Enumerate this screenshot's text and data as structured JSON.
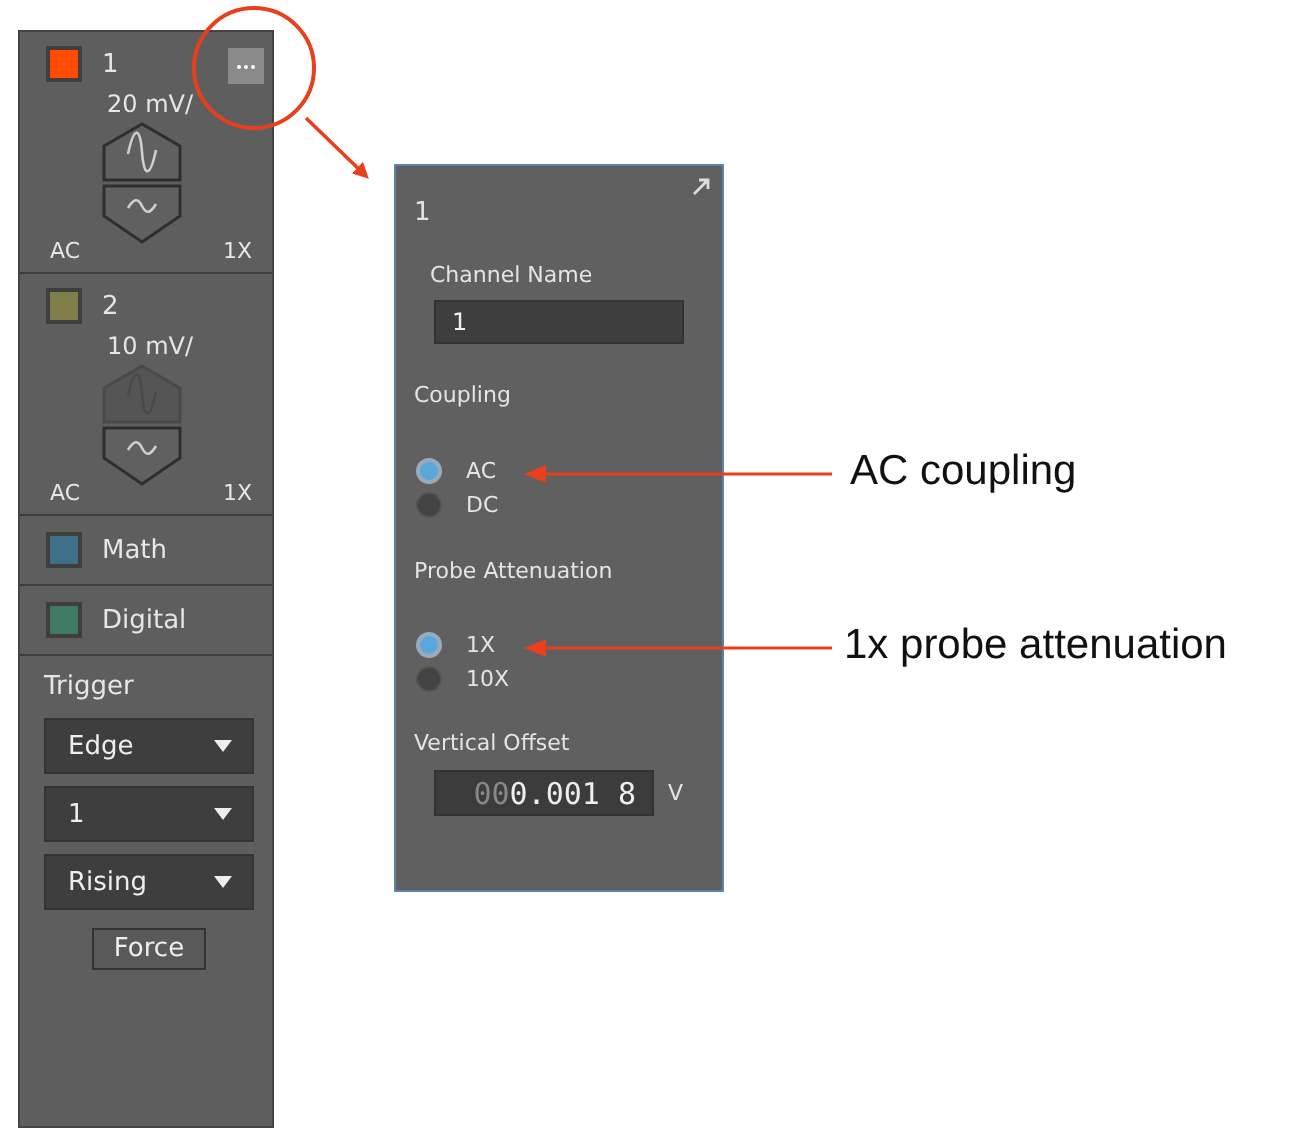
{
  "channels": [
    {
      "number": "1",
      "color": "#ff4a00",
      "menu": true,
      "scale": "20 mV/",
      "scale_up_disabled": false,
      "coupling": "AC",
      "probe": "1X"
    },
    {
      "number": "2",
      "color": "#7f7d4a",
      "menu": false,
      "scale": "10 mV/",
      "scale_up_disabled": true,
      "coupling": "AC",
      "probe": "1X"
    }
  ],
  "extra_channels": [
    {
      "label": "Math",
      "color": "#3f6f86"
    },
    {
      "label": "Digital",
      "color": "#3f7a62"
    }
  ],
  "trigger": {
    "title": "Trigger",
    "dropdowns": [
      "Edge",
      "1",
      "Rising"
    ],
    "force_button": "Force"
  },
  "channel_popup": {
    "title": "1",
    "name_label": "Channel Name",
    "name_value": "1",
    "coupling_label": "Coupling",
    "coupling_options": [
      {
        "label": "AC",
        "selected": true
      },
      {
        "label": "DC",
        "selected": false
      }
    ],
    "probe_label": "Probe Attenuation",
    "probe_options": [
      {
        "label": "1X",
        "selected": true
      },
      {
        "label": "10X",
        "selected": false
      }
    ],
    "offset_label": "Vertical Offset",
    "offset_dim": "00",
    "offset_value": "0.001 8",
    "offset_unit": "V"
  },
  "callouts": [
    {
      "text": "AC coupling"
    },
    {
      "text": "1x probe attenuation"
    }
  ]
}
